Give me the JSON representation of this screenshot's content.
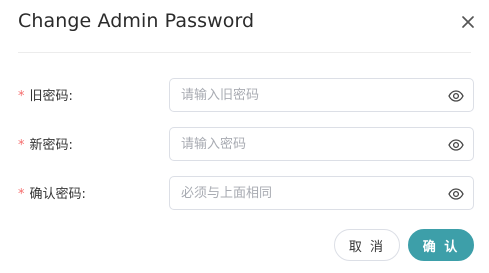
{
  "dialog": {
    "title": "Change Admin Password"
  },
  "form": {
    "required_mark": "*",
    "fields": [
      {
        "label": "旧密码:",
        "placeholder": "请输入旧密码",
        "value": ""
      },
      {
        "label": "新密码:",
        "placeholder": "请输入密码",
        "value": ""
      },
      {
        "label": "确认密码:",
        "placeholder": "必须与上面相同",
        "value": ""
      }
    ]
  },
  "footer": {
    "cancel_label": "取 消",
    "confirm_label": "确 认"
  },
  "colors": {
    "accent": "#3d9fa9",
    "required": "#f56c6c",
    "border": "#dcdfe6"
  },
  "icons": {
    "close": "close-icon",
    "reveal": "eye-icon"
  }
}
